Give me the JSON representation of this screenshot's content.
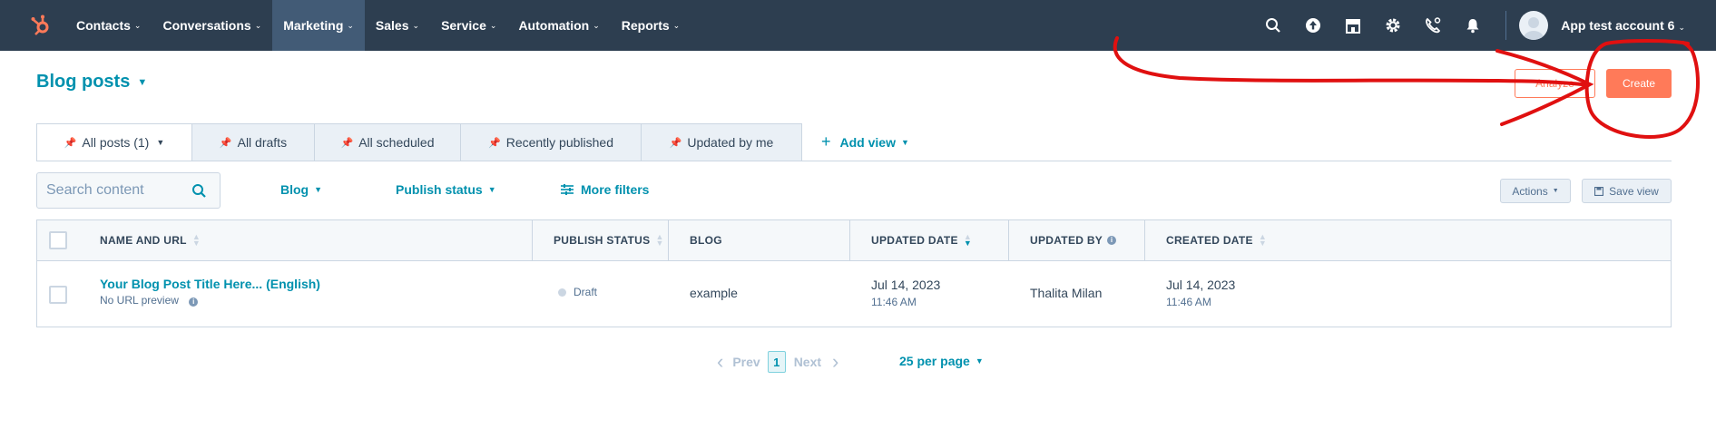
{
  "nav": {
    "items": [
      {
        "label": "Contacts"
      },
      {
        "label": "Conversations"
      },
      {
        "label": "Marketing"
      },
      {
        "label": "Sales"
      },
      {
        "label": "Service"
      },
      {
        "label": "Automation"
      },
      {
        "label": "Reports"
      }
    ],
    "active_item": "Marketing",
    "account_label": "App test account 6",
    "icons": [
      "search-icon",
      "upgrade-arrow-icon",
      "marketplace-icon",
      "settings-gear-icon",
      "calling-icon",
      "notifications-bell-icon"
    ]
  },
  "page": {
    "title": "Blog posts",
    "analyze_label": "Analyze",
    "create_label": "Create"
  },
  "tabs": [
    {
      "label": "All posts (1)"
    },
    {
      "label": "All drafts"
    },
    {
      "label": "All scheduled"
    },
    {
      "label": "Recently published"
    },
    {
      "label": "Updated by me"
    }
  ],
  "add_view_label": "Add view",
  "filters": {
    "search_placeholder": "Search content",
    "blog_label": "Blog",
    "publish_status_label": "Publish status",
    "more_filters_label": "More filters",
    "actions_label": "Actions",
    "save_view_label": "Save view"
  },
  "table": {
    "headers": {
      "name": "NAME AND URL",
      "status": "PUBLISH STATUS",
      "blog": "BLOG",
      "updated_date": "UPDATED DATE",
      "updated_by": "UPDATED BY",
      "created_date": "CREATED DATE"
    },
    "rows": [
      {
        "title": "Your Blog Post Title Here...",
        "language": "(English)",
        "url_preview": "No URL preview",
        "status": "Draft",
        "blog": "example",
        "updated_date": "Jul 14, 2023",
        "updated_time": "11:46 AM",
        "updated_by": "Thalita Milan",
        "created_date": "Jul 14, 2023",
        "created_time": "11:46 AM"
      }
    ]
  },
  "pagination": {
    "prev_label": "Prev",
    "current_page": "1",
    "next_label": "Next",
    "per_page_label": "25 per page"
  },
  "colors": {
    "nav_bg": "#2d3e50",
    "accent_teal": "#0091ae",
    "create_orange": "#ff7a59",
    "annotation_red": "#e01010"
  }
}
